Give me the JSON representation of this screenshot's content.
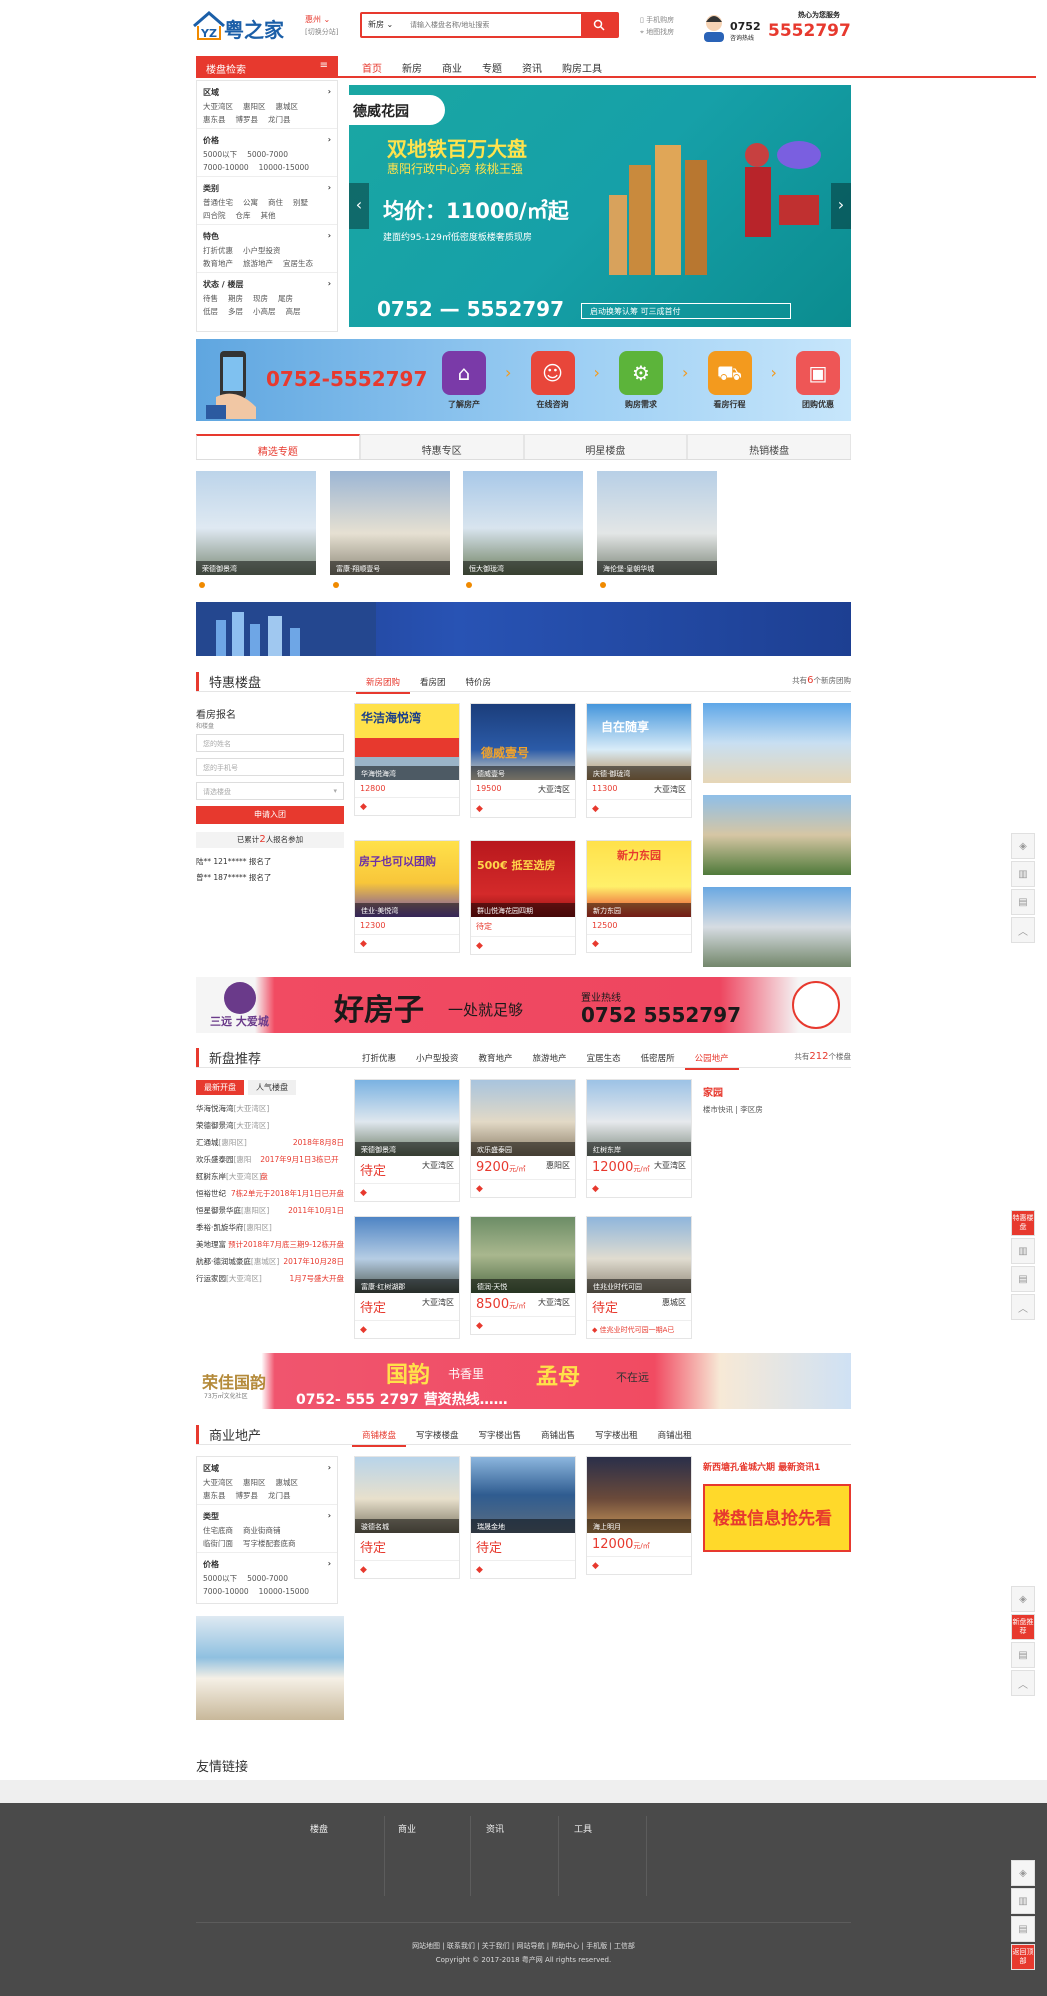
{
  "header": {
    "logo_text": "粤之家",
    "city": "惠州",
    "city_switch": "[切换分站]",
    "search_type": "新房",
    "search_placeholder": "请输入楼盘名称/地址搜索",
    "mobile_link": "手机购房",
    "map_link": "地图找房",
    "hotline_slogan": "热心为您服务",
    "hotline_label": "咨询热线",
    "hotline_prefix": "0752",
    "hotline_number": "5552797"
  },
  "nav": {
    "title": "楼盘检索",
    "items": [
      "首页",
      "新房",
      "商业",
      "专题",
      "资讯",
      "购房工具"
    ]
  },
  "sidebar": {
    "groups": [
      {
        "title": "区域",
        "items": [
          "大亚湾区",
          "惠阳区",
          "惠城区",
          "惠东县",
          "博罗县",
          "龙门县"
        ]
      },
      {
        "title": "价格",
        "items": [
          "5000以下",
          "5000-7000",
          "7000-10000",
          "10000-15000"
        ]
      },
      {
        "title": "类别",
        "items": [
          "普通住宅",
          "公寓",
          "商住",
          "别墅",
          "四合院",
          "仓库",
          "其他"
        ]
      },
      {
        "title": "特色",
        "items": [
          "打折优惠",
          "小户型投资",
          "教育地产",
          "旅游地产",
          "宜居生态"
        ]
      },
      {
        "title": "状态 / 楼层",
        "items": [
          "待售",
          "期房",
          "现房",
          "尾房",
          "低层",
          "多层",
          "小高层",
          "高层"
        ]
      }
    ]
  },
  "banner": {
    "brand": "德威花园",
    "headline": "双地铁百万大盘",
    "subline": "惠阳行政中心旁 核桃王强",
    "price": "均价：11000/㎡起",
    "area": "建面约95-129㎡低密度板楼奢质现房",
    "phone": "0752 — 5552797",
    "note": "启动换筹认筹 可三成首付"
  },
  "promo": {
    "phone": "0752-5552797",
    "steps": [
      "了解房产",
      "在线咨询",
      "购房需求",
      "看房行程",
      "团购优惠"
    ]
  },
  "feature_tabs": [
    "精选专题",
    "特惠专区",
    "明星楼盘",
    "热销楼盘"
  ],
  "feature_items": [
    "荣德御景湾",
    "富康·翔顺壹号",
    "恒大御珑湾",
    "海伦堡·皇朝华城"
  ],
  "special": {
    "title": "特惠楼盘",
    "tabs": [
      "新房团购",
      "看房团",
      "特价房"
    ],
    "count_prefix": "共有",
    "count": "6",
    "count_suffix": "个新房团购",
    "signup_title": "看房报名",
    "signup_sub": "和楼盘",
    "name_placeholder": "您的姓名",
    "phone_placeholder": "您的手机号",
    "select_placeholder": "请选楼盘",
    "submit": "申请入团",
    "joined_prefix": "已累计",
    "joined": "2",
    "joined_suffix": "人报名参加",
    "joined_list": [
      "陆** 121***** 报名了",
      "曾** 187***** 报名了"
    ],
    "cards": [
      {
        "name": "华海悦海湾",
        "price": "12800",
        "area": "",
        "banner": "华洁海悦湾"
      },
      {
        "name": "德威壹号",
        "price": "19500",
        "area": "大亚湾区",
        "banner": "德威壹号"
      },
      {
        "name": "庆德·御珑湾",
        "price": "11300",
        "area": "大亚湾区",
        "banner": "自在随享"
      },
      {
        "name": "佳业·美悦湾",
        "price": "12300",
        "area": "",
        "banner": "房子也可以团购"
      },
      {
        "name": "群山悦海花园四期",
        "price": "待定",
        "area": "",
        "banner": "500€ 抵至选房"
      },
      {
        "name": "新力东园",
        "price": "12500",
        "area": "",
        "banner": "新力东园"
      }
    ]
  },
  "ad_good_house": {
    "brand": "三远 大爱城",
    "slogan": "好房子",
    "slogan_tail": "一处就足够",
    "hotline_label": "置业热线",
    "hotline": "0752 5552797"
  },
  "newprops": {
    "title": "新盘推荐",
    "tabs": [
      "打折优惠",
      "小户型投资",
      "教育地产",
      "旅游地产",
      "宜居生态",
      "低密居所",
      "公园地产"
    ],
    "count_prefix": "共有",
    "count": "212",
    "count_suffix": "个楼盘",
    "list_tabs": [
      "最新开盘",
      "人气楼盘"
    ],
    "list": [
      {
        "name": "华海悦海湾",
        "area": "[大亚湾区]",
        "date": ""
      },
      {
        "name": "荣德御景湾",
        "area": "[大亚湾区]",
        "date": ""
      },
      {
        "name": "汇通城",
        "area": "[惠阳区]",
        "date": "2018年8月8日"
      },
      {
        "name": "欢乐盛泰园",
        "area": "[惠阳区]",
        "date": "2017年9月1日3栋已开盘"
      },
      {
        "name": "红树东岸",
        "area": "[大亚湾区]",
        "date": ""
      },
      {
        "name": "恒裕世纪",
        "area": "",
        "date": "7栋2单元于2018年1月1日已开盘"
      },
      {
        "name": "恒星御景华庭",
        "area": "[惠阳区]",
        "date": "2011年10月1日"
      },
      {
        "name": "季裕·凯旋华府",
        "area": "[惠阳区]",
        "date": ""
      },
      {
        "name": "美地理富",
        "area": "",
        "date": "预计2018年7月底三期9-12栋开盘"
      },
      {
        "name": "航都·德润城豪庭",
        "area": "[惠城区]",
        "date": "2017年10月28日"
      },
      {
        "name": "行运家园",
        "area": "[大亚湾区]",
        "date": "1月7号盛大开盘"
      }
    ],
    "cards": [
      {
        "name": "荣德御景湾",
        "price": "待定",
        "unit": "",
        "area": "大亚湾区"
      },
      {
        "name": "欢乐盛泰园",
        "price": "9200",
        "unit": "元/㎡",
        "area": "惠阳区"
      },
      {
        "name": "红树东岸",
        "price": "12000",
        "unit": "元/㎡",
        "area": "大亚湾区"
      },
      {
        "name": "富康·红树湖郡",
        "price": "待定",
        "unit": "",
        "area": "大亚湾区"
      },
      {
        "name": "德润·天悦",
        "price": "8500",
        "unit": "元/㎡",
        "area": "大亚湾区"
      },
      {
        "name": "佳兆业时代可园",
        "price": "待定",
        "unit": "",
        "area": "惠城区"
      }
    ],
    "last_card_tag": "佳兆业时代可园一期A已",
    "side_title": "家园",
    "side_text": "楼市快讯 | 李区房"
  },
  "ad_guoyun": {
    "brand": "荣佳国韵",
    "brand_sub": "73万㎡文化社区",
    "title": "国韵",
    "title2": "书香里",
    "title3": "孟母",
    "tail": "不在远",
    "phone": "0752- 555 2797 营资热线……"
  },
  "commercial": {
    "title": "商业地产",
    "tabs": [
      "商铺楼盘",
      "写字楼楼盘",
      "写字楼出售",
      "商铺出售",
      "写字楼出租",
      "商铺出租"
    ],
    "side_groups": [
      {
        "title": "区域",
        "items": [
          "大亚湾区",
          "惠阳区",
          "惠城区",
          "惠东县",
          "博罗县",
          "龙门县"
        ]
      },
      {
        "title": "类型",
        "items": [
          "住宅底商",
          "商业街商铺",
          "临街门面",
          "写字楼配套底商"
        ]
      },
      {
        "title": "价格",
        "items": [
          "5000以下",
          "5000-7000",
          "7000-10000",
          "10000-15000"
        ]
      }
    ],
    "cards": [
      {
        "name": "骏德名城",
        "price": "待定",
        "unit": ""
      },
      {
        "name": "瑞晟金地",
        "price": "待定",
        "unit": ""
      },
      {
        "name": "海上明月",
        "price": "12000",
        "unit": "元/㎡"
      }
    ],
    "news_title": "新西塘孔雀城六期 最新资讯1",
    "poster": "楼盘信息抢先看"
  },
  "friends_title": "友情链接",
  "footer": {
    "cols": [
      "楼盘",
      "商业",
      "资讯",
      "工具"
    ],
    "links": [
      "网站地图",
      "联系我们",
      "关于我们",
      "网站导航",
      "帮助中心",
      "手机版",
      "工信部"
    ],
    "copyright": "Copyright © 2017-2018 粤产网 All rights reserved."
  },
  "right_rail": {
    "mid_label": "特惠楼盘",
    "low_label": "新盘推荐",
    "bottom_label": "返回顶部"
  },
  "colors": {
    "accent": "#e7392e",
    "footer": "#4a4a4a"
  }
}
